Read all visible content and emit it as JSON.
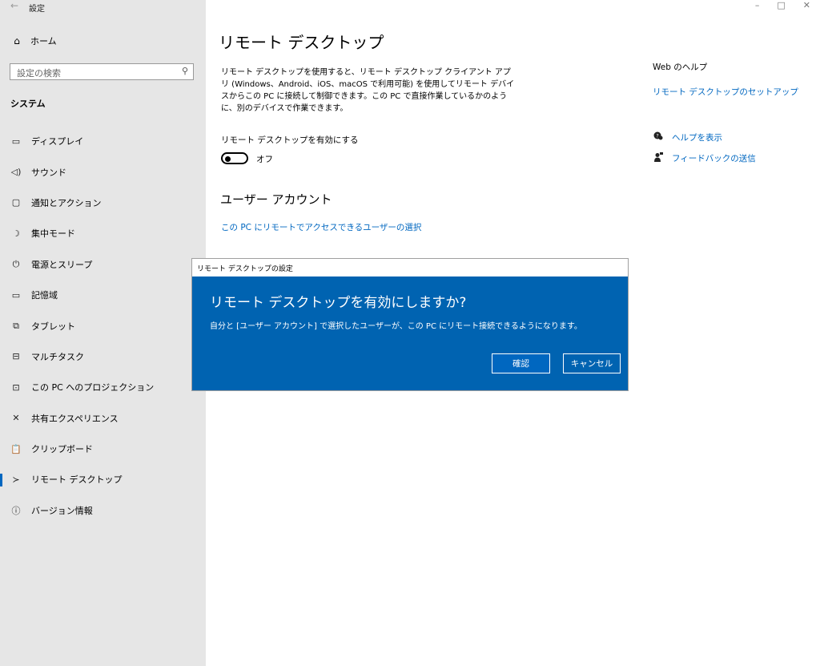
{
  "window": {
    "title": "設定",
    "back": "←",
    "minimize": "–",
    "maximize": "□",
    "close": "✕"
  },
  "sidebar": {
    "home": {
      "icon": "⌂",
      "label": "ホーム"
    },
    "search_placeholder": "設定の検索",
    "search_icon": "⚲",
    "section": "システム",
    "items": [
      {
        "icon": "▭",
        "label": "ディスプレイ"
      },
      {
        "icon": "◁)",
        "label": "サウンド"
      },
      {
        "icon": "▢",
        "label": "通知とアクション"
      },
      {
        "icon": "☽",
        "label": "集中モード"
      },
      {
        "icon": "⏻",
        "label": "電源とスリープ"
      },
      {
        "icon": "▭",
        "label": "記憶域"
      },
      {
        "icon": "⧉",
        "label": "タブレット"
      },
      {
        "icon": "⊟",
        "label": "マルチタスク"
      },
      {
        "icon": "⊡",
        "label": "この PC へのプロジェクション"
      },
      {
        "icon": "✕",
        "label": "共有エクスペリエンス"
      },
      {
        "icon": "📋",
        "label": "クリップボード"
      },
      {
        "icon": "≻",
        "label": "リモート デスクトップ"
      },
      {
        "icon": "ⓘ",
        "label": "バージョン情報"
      }
    ]
  },
  "main": {
    "title": "リモート デスクトップ",
    "description": "リモート デスクトップを使用すると、リモート デスクトップ クライアント アプリ (Windows、Android、iOS、macOS で利用可能) を使用してリモート デバイスからこの PC に接続して制御できます。この PC で直接作業しているかのように、別のデバイスで作業できます。",
    "toggle_label": "リモート デスクトップを有効にする",
    "toggle_state": "オフ",
    "user_accounts_heading": "ユーザー アカウント",
    "user_accounts_link": "この PC にリモートでアクセスできるユーザーの選択"
  },
  "help": {
    "title": "Web のヘルプ",
    "link": "リモート デスクトップのセットアップ",
    "show_help": "ヘルプを表示",
    "feedback": "フィードバックの送信"
  },
  "dialog": {
    "window_title": "リモート デスクトップの設定",
    "heading": "リモート デスクトップを有効にしますか?",
    "message": "自分と [ユーザー アカウント] で選択したユーザーが、この PC にリモート接続できるようになります。",
    "confirm": "確認",
    "cancel": "キャンセル"
  },
  "colors": {
    "accent": "#0067c0",
    "dialog_bg": "#0063b1",
    "sidebar_bg": "#e6e6e6"
  }
}
